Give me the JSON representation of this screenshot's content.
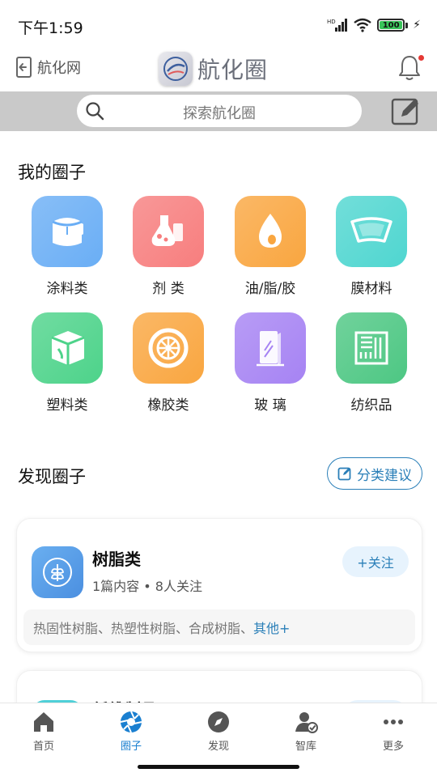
{
  "status_bar": {
    "time": "下午1:59",
    "battery": "100"
  },
  "header": {
    "back_label": "航化网",
    "brand_text": "航化圈"
  },
  "search": {
    "placeholder": "探索航化圈"
  },
  "my_circles": {
    "title": "我的圈子",
    "items": [
      {
        "label": "涂料类",
        "icon": "paint-bucket-icon",
        "color": "#6aaef5"
      },
      {
        "label": "剂 类",
        "icon": "flask-icon",
        "color": "#f77e7e"
      },
      {
        "label": "油/脂/胶",
        "icon": "oil-drop-icon",
        "color": "#f9a640"
      },
      {
        "label": "膜材料",
        "icon": "windshield-icon",
        "color": "#4fd6d0"
      },
      {
        "label": "塑料类",
        "icon": "cube-icon",
        "color": "#4dd38a"
      },
      {
        "label": "橡胶类",
        "icon": "tire-icon",
        "color": "#f9a640"
      },
      {
        "label": "玻 璃",
        "icon": "glass-pane-icon",
        "color": "#a683f3"
      },
      {
        "label": "纺织品",
        "icon": "fabric-icon",
        "color": "#4dc783"
      }
    ]
  },
  "discover": {
    "title": "发现圈子",
    "suggest_label": "分类建议",
    "cards": [
      {
        "title": "树脂类",
        "meta": "1篇内容 • 8人关注",
        "follow_label": "+关注",
        "tags": "热固性树脂、热塑性树脂、合成树脂、",
        "more_label": "其他+",
        "icon": "leaf-icon"
      },
      {
        "title": "纤维制品"
      }
    ]
  },
  "bottom_nav": [
    {
      "label": "首页",
      "icon": "home-icon",
      "active": false
    },
    {
      "label": "圈子",
      "icon": "aperture-icon",
      "active": true
    },
    {
      "label": "发现",
      "icon": "compass-icon",
      "active": false
    },
    {
      "label": "智库",
      "icon": "expert-icon",
      "active": false
    },
    {
      "label": "更多",
      "icon": "more-icon",
      "active": false
    }
  ],
  "colors": {
    "accent": "#1a7fd0",
    "link": "#2a7fb8",
    "search_band": "#c9c9c9"
  }
}
